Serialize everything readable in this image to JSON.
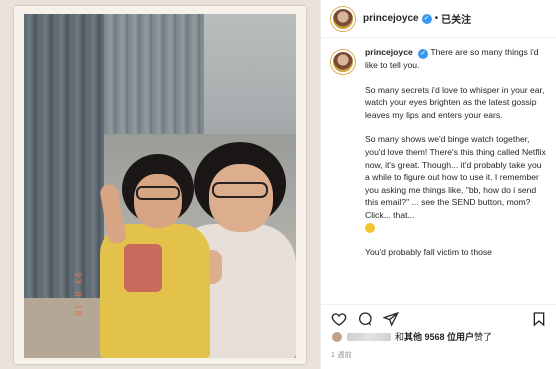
{
  "post": {
    "date_stamp": "93 8 18"
  },
  "header": {
    "username": "princejoyce",
    "verified_icon": "verified-badge-icon",
    "separator": "•",
    "follow_state": "已关注"
  },
  "caption": {
    "username": "princejoyce",
    "paragraphs": [
      "There are so many things i'd like to tell you.",
      "So many secrets i'd love to whisper in your ear, watch your eyes brighten as the latest gossip leaves my lips and enters your ears.",
      "So many shows we'd binge watch together, you'd love them! There's this thing called Netflix now, it's great. Though... it'd probably take you a while to figure out how to use it. I remember you asking me things like, \"bb, how do i send this email?\" ... see the SEND button, mom? Click... that...",
      "You'd probably fall victim to those"
    ]
  },
  "actions": {
    "like_icon": "heart-icon",
    "comment_icon": "comment-icon",
    "share_icon": "share-icon",
    "save_icon": "bookmark-icon"
  },
  "likes": {
    "prefix": "和",
    "text": "其他 9568 位用户",
    "suffix": "赞了"
  },
  "timestamp": "1 週前"
}
